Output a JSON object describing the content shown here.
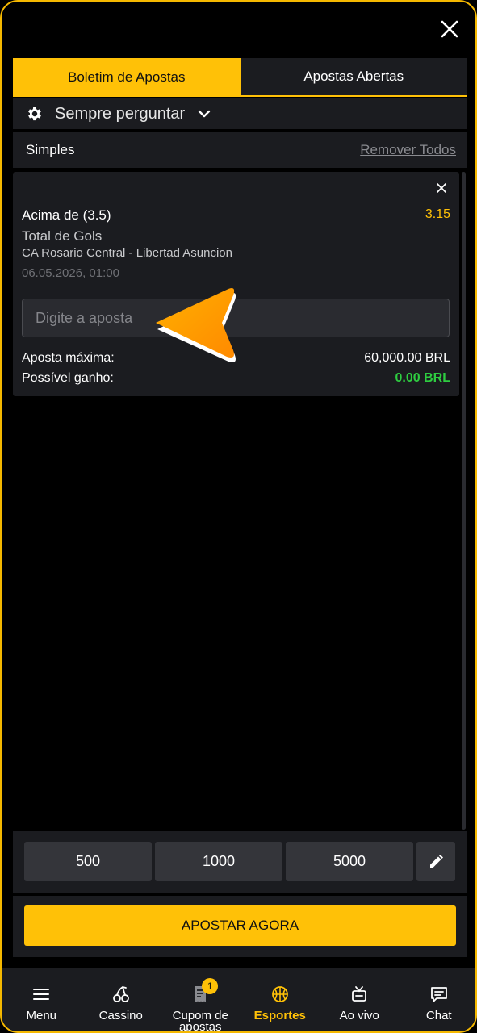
{
  "tabs": [
    {
      "label": "Boletim de Apostas",
      "active": true
    },
    {
      "label": "Apostas Abertas",
      "active": false
    }
  ],
  "settings": {
    "label": "Sempre perguntar",
    "icon": "gear-icon"
  },
  "slip": {
    "type_label": "Simples",
    "remove_all": "Remover Todos"
  },
  "bet": {
    "selection": "Acima de (3.5)",
    "odds": "3.15",
    "market": "Total de Gols",
    "event": "CA Rosario Central - Libertad Asuncion",
    "datetime": "06.05.2026, 01:00",
    "stake_placeholder": "Digite a aposta",
    "max_label": "Aposta máxima:",
    "max_value": "60,000.00 BRL",
    "win_label": "Possível ganho:",
    "win_value": "0.00 BRL"
  },
  "quick_stakes": [
    "500",
    "1000",
    "5000"
  ],
  "place_button": "APOSTAR AGORA",
  "nav": [
    {
      "label": "Menu",
      "icon": "menu-icon"
    },
    {
      "label": "Cassino",
      "icon": "cherries-icon"
    },
    {
      "label": "Cupom de apostas",
      "icon": "receipt-icon",
      "badge": "1"
    },
    {
      "label": "Esportes",
      "icon": "basketball-icon",
      "active": true
    },
    {
      "label": "Ao vivo",
      "icon": "live-icon"
    },
    {
      "label": "Chat",
      "icon": "chat-icon"
    }
  ],
  "colors": {
    "accent": "#ffc107",
    "panel": "#1b1c20",
    "win": "#2ecc40"
  }
}
